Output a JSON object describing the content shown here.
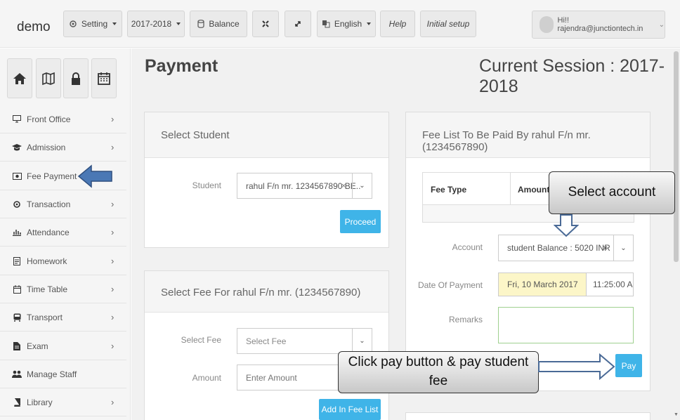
{
  "brand": "demo",
  "topbar": {
    "setting": "Setting",
    "session_select": "2017-2018",
    "balance": "Balance",
    "language": "English",
    "help": "Help",
    "initial_setup": "Initial setup",
    "user_greeting": "Hi!! rajendra@junctiontech.in"
  },
  "sidebar": {
    "quick_icons": [
      "home-icon",
      "map-icon",
      "lock-icon",
      "calendar-icon"
    ],
    "items": [
      {
        "label": "Front Office",
        "icon": "monitor-icon"
      },
      {
        "label": "Admission",
        "icon": "graduation-cap-icon"
      },
      {
        "label": "Fee Payment",
        "icon": "money-icon"
      },
      {
        "label": "Transaction",
        "icon": "cog-icon"
      },
      {
        "label": "Attendance",
        "icon": "bar-chart-icon"
      },
      {
        "label": "Homework",
        "icon": "document-icon"
      },
      {
        "label": "Time Table",
        "icon": "calendar-icon"
      },
      {
        "label": "Transport",
        "icon": "bus-icon"
      },
      {
        "label": "Exam",
        "icon": "file-icon"
      },
      {
        "label": "Manage Staff",
        "icon": "users-icon"
      },
      {
        "label": "Library",
        "icon": "book-icon"
      }
    ]
  },
  "page": {
    "title": "Payment",
    "session": "Current Session : 2017-2018"
  },
  "select_student": {
    "title": "Select Student",
    "student_label": "Student",
    "student_value": "rahul F/n mr. 1234567890 BE..",
    "proceed": "Proceed"
  },
  "select_fee": {
    "title": "Select Fee For rahul F/n mr. (1234567890)",
    "fee_label": "Select Fee",
    "fee_placeholder": "Select Fee",
    "amount_label": "Amount",
    "amount_placeholder": "Enter Amount",
    "add_button": "Add In Fee List"
  },
  "fee_list": {
    "title": "Fee List To Be Paid By rahul F/n mr. (1234567890)",
    "col_fee_type": "Fee Type",
    "col_amount": "Amount",
    "account_label": "Account",
    "account_value": "student Balance : 5020 INR",
    "date_label": "Date Of Payment",
    "date_value": "Fri, 10 March 2017",
    "time_value": "11:25:00 A",
    "remarks_label": "Remarks",
    "pay": "Pay"
  },
  "callouts": {
    "select_account": "Select account",
    "pay_hint": "Click pay button & pay student fee"
  },
  "colors": {
    "accent_blue": "#3fb4e8",
    "arrow_blue": "#4a78b5",
    "date_highlight": "#fcf6c8",
    "remarks_border": "#9fd08f"
  }
}
